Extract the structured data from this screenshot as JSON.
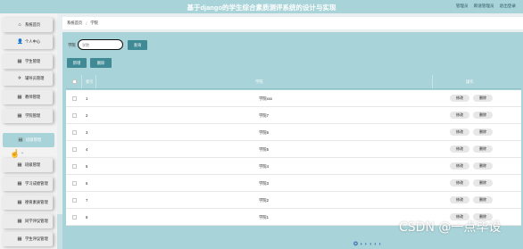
{
  "app": {
    "title": "基于django的学生综合素质测评系统的设计与实现",
    "user_links": [
      "管理员",
      "麻速管理员",
      "退出登录"
    ]
  },
  "sidebar": {
    "items": [
      {
        "icon": "home-icon",
        "glyph": "⌂",
        "label": "系统首页"
      },
      {
        "icon": "user-icon",
        "glyph": "👤",
        "label": "个人中心"
      },
      {
        "icon": "grid-icon",
        "glyph": "▦",
        "label": "学生管理"
      },
      {
        "icon": "send-icon",
        "glyph": "✈",
        "label": "辅导员管理"
      },
      {
        "icon": "grid-icon",
        "glyph": "▦",
        "label": "教师管理"
      },
      {
        "icon": "grid-icon",
        "glyph": "▦",
        "label": "学院管理"
      },
      {
        "icon": "document-icon",
        "glyph": "▤",
        "label": "班级管理"
      },
      {
        "icon": "grid-icon",
        "glyph": "▦",
        "label": "班级管理"
      },
      {
        "icon": "grid-icon",
        "glyph": "▦",
        "label": "学习成绩管理"
      },
      {
        "icon": "grid-icon",
        "glyph": "▦",
        "label": "德育素质管理"
      },
      {
        "icon": "grid-icon",
        "glyph": "▦",
        "label": "同学评议管理"
      },
      {
        "icon": "grid-icon",
        "glyph": "▦",
        "label": "学生评议管理"
      }
    ]
  },
  "breadcrumb": {
    "home": "系统首页",
    "separator": "/",
    "current": "学院"
  },
  "search": {
    "label": "学院",
    "placeholder": "学院",
    "button": "查询"
  },
  "actions": {
    "add": "新增",
    "delete": "删除"
  },
  "table": {
    "headers": {
      "index": "索引",
      "name": "学院",
      "ops": "操作"
    },
    "row_buttons": {
      "edit": "修改",
      "delete": "删除"
    },
    "rows": [
      {
        "index": "1",
        "name": "学院xxx"
      },
      {
        "index": "2",
        "name": "学院7"
      },
      {
        "index": "3",
        "name": "学院6"
      },
      {
        "index": "4",
        "name": "学院5"
      },
      {
        "index": "5",
        "name": "学院4"
      },
      {
        "index": "6",
        "name": "学院3"
      },
      {
        "index": "7",
        "name": "学院2"
      },
      {
        "index": "8",
        "name": "学院1"
      }
    ]
  },
  "watermark": "CSDN @一点毕设",
  "colors": {
    "accent": "#a8d3d8",
    "button": "#3f8a95",
    "row_button": "#e7e7e7"
  }
}
